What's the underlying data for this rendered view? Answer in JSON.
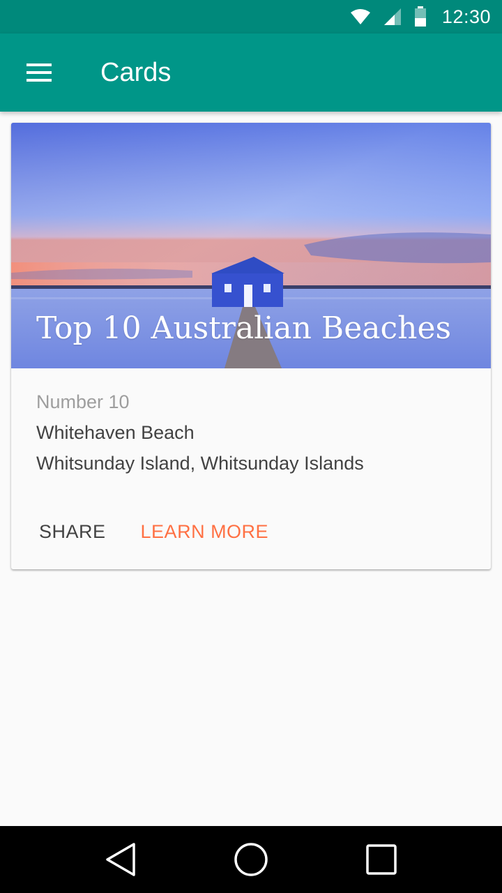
{
  "status_bar": {
    "time": "12:30",
    "icons": [
      "wifi-icon",
      "signal-icon",
      "battery-icon"
    ]
  },
  "app_bar": {
    "title": "Cards",
    "menu_icon": "menu-icon",
    "color": "#009688"
  },
  "card": {
    "image_title": "Top 10 Australian Beaches",
    "subtitle": "Number 10",
    "line1": "Whitehaven Beach",
    "line2": "Whitsunday Island, Whitsunday Islands",
    "actions": {
      "share": "SHARE",
      "learn_more": "LEARN MORE"
    },
    "accent_color": "#ff7043"
  },
  "nav_bar": {
    "icons": [
      "back-icon",
      "home-icon",
      "recents-icon"
    ]
  }
}
